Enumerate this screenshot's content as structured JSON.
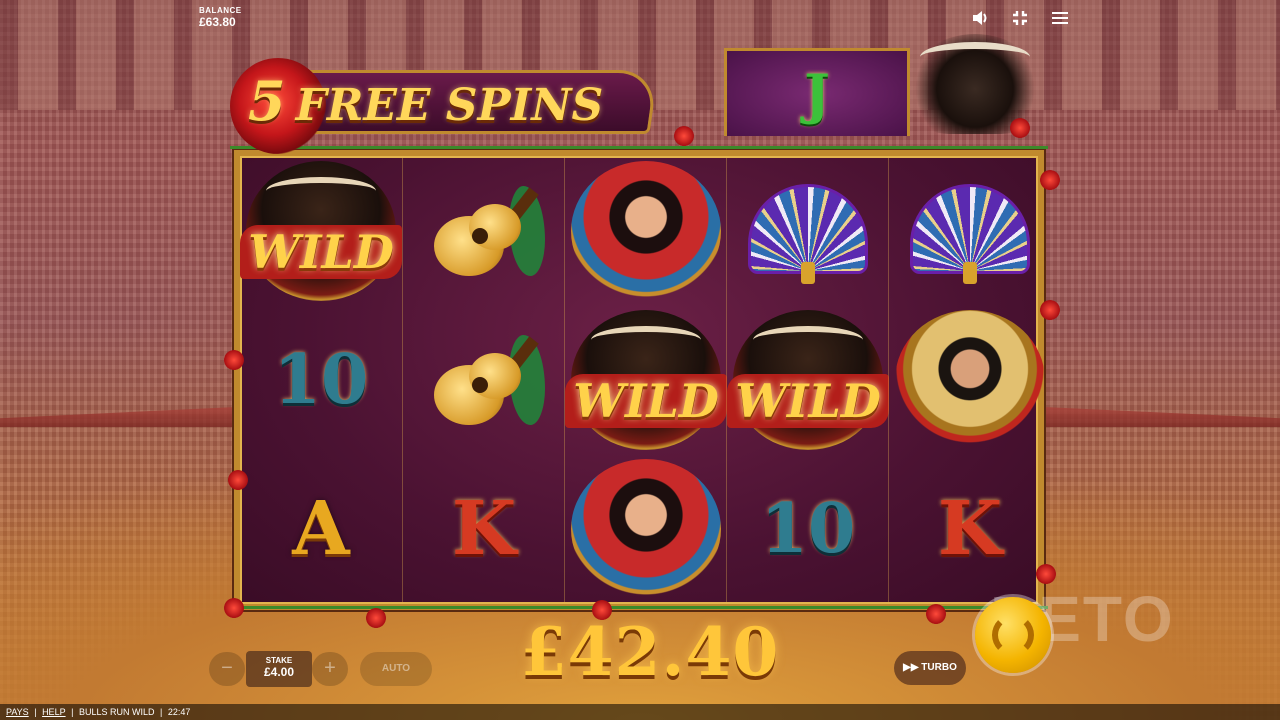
{
  "header": {
    "balance_label": "BALANCE",
    "balance_value": "£63.80",
    "icons": [
      "volume-icon",
      "fullscreen-icon",
      "menu-icon"
    ]
  },
  "feature": {
    "free_spins_count": "5",
    "free_spins_label": "FREE SPINS",
    "top_symbol": "J"
  },
  "reels": {
    "columns": [
      [
        "WILD",
        "10",
        "A"
      ],
      [
        "guitar",
        "guitar",
        "K"
      ],
      [
        "lady",
        "WILD",
        "lady"
      ],
      [
        "fan",
        "WILD",
        "10"
      ],
      [
        "fan",
        "matador",
        "K"
      ]
    ],
    "labels": {
      "wild": "WILD",
      "ten": "10",
      "ace": "A",
      "king": "K"
    }
  },
  "win": {
    "amount": "£42.40"
  },
  "controls": {
    "minus": "−",
    "plus": "+",
    "stake_label": "STAKE",
    "stake_value": "£4.00",
    "auto_label": "AUTO",
    "turbo_label": "▶▶ TURBO"
  },
  "watermark": "BETO",
  "footer": {
    "pays": "PAYS",
    "help": "HELP",
    "game_name": "BULLS RUN WILD",
    "time": "22:47",
    "separator": "|"
  },
  "colors": {
    "gold": "#ffc63a",
    "reel_bg": "#4b1232",
    "frame": "#c08a2e",
    "spin_button": "#f4b400"
  }
}
